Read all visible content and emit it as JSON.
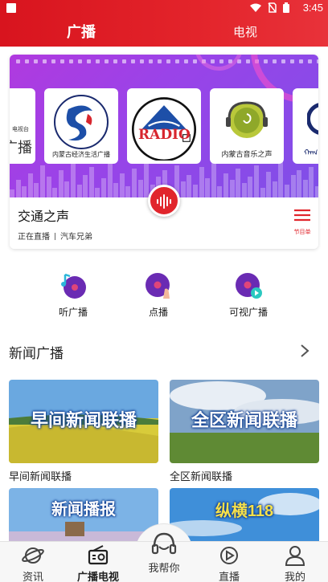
{
  "status_bar": {
    "time": "3:45"
  },
  "top_tabs": [
    {
      "label": "广播",
      "active": true
    },
    {
      "label": "电视",
      "active": false
    }
  ],
  "hero": {
    "stations": [
      {
        "label": "",
        "partial_text": "广播",
        "partial_small": "电视台"
      },
      {
        "label": "内蒙古经济生活广播"
      },
      {
        "label": "",
        "logo_text": "RADIO"
      },
      {
        "label": "内蒙古音乐之声"
      },
      {
        "label": ""
      }
    ],
    "now_playing": {
      "title": "交通之声",
      "status": "正在直播",
      "program": "汽车兄弟"
    },
    "list_label": "节目单"
  },
  "quick_actions": [
    {
      "label": "听广播",
      "icon": "music-disc-icon"
    },
    {
      "label": "点播",
      "icon": "disc-tap-icon"
    },
    {
      "label": "可视广播",
      "icon": "disc-play-icon"
    }
  ],
  "news_section": {
    "title": "新闻广播",
    "cards": [
      {
        "image_text": "早间新闻联播",
        "caption": "早间新闻联播"
      },
      {
        "image_text": "全区新闻联播",
        "caption": "全区新闻联播"
      },
      {
        "image_text": "新闻播报",
        "caption": ""
      },
      {
        "image_text": "纵横118",
        "caption": ""
      }
    ]
  },
  "bottom_nav": [
    {
      "label": "资讯",
      "icon": "planet-icon"
    },
    {
      "label": "广播电视",
      "icon": "radio-icon"
    },
    {
      "label": "我帮你",
      "icon": "headset-icon"
    },
    {
      "label": "直播",
      "icon": "play-circle-icon"
    },
    {
      "label": "我的",
      "icon": "user-icon"
    }
  ],
  "colors": {
    "brand_red": "#e1252c",
    "purple": "#9a43e8"
  }
}
